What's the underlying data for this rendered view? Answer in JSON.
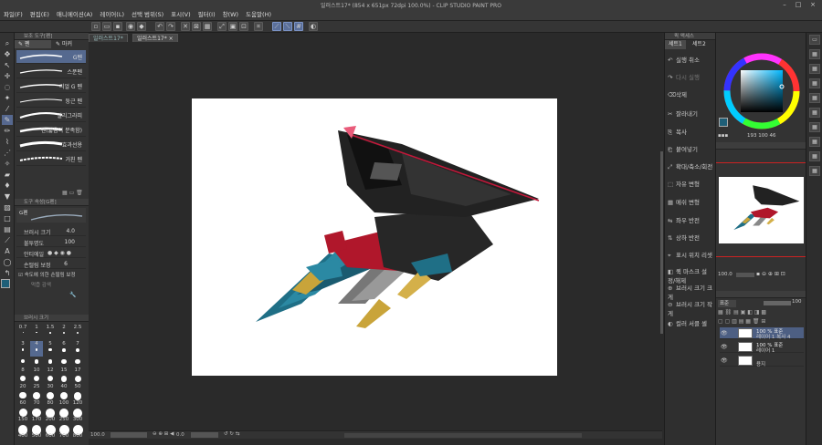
{
  "window": {
    "title": "일러스트17* (854 x 651px 72dpi 100.0%) - CLIP STUDIO PAINT PRO"
  },
  "menu": [
    "파일(F)",
    "편집(E)",
    "애니메이션(A)",
    "레이어(L)",
    "선택 범위(S)",
    "표시(V)",
    "필터(I)",
    "창(W)",
    "도움말(H)"
  ],
  "document_tabs": [
    "일러스트17*",
    "일러스트17*"
  ],
  "left_panel": {
    "subtool_header": "보조 도구[펜]",
    "subtabs": [
      "펜",
      "마커"
    ],
    "brushes": [
      "G펜",
      "스푼펜",
      "리얼 G 펜",
      "둥근 펜",
      "멀리그라피",
      "펜(얇음이 분족함)",
      "효과선용",
      "거친 펜"
    ],
    "tool_property_header": "도구 속성[G펜]",
    "tool_property_name": "G펜",
    "props": [
      {
        "label": "브러시 크기",
        "value": "4.0"
      },
      {
        "label": "불투명도",
        "value": "100"
      },
      {
        "label": "안티에일",
        "value": ""
      },
      {
        "label": "손떨림 보정",
        "value": "6"
      }
    ],
    "checkbox_label": "속도에 의한 손떨림 보정",
    "extra_label": "먹즙 감색",
    "brush_size_header": "브러시 크기",
    "sizes_row1": [
      "0.7",
      "1",
      "1.5",
      "2",
      "2.5"
    ],
    "sizes_row2": [
      "3",
      "4",
      "5",
      "6",
      "7"
    ],
    "sizes_row3": [
      "8",
      "10",
      "12",
      "15",
      "17"
    ],
    "sizes_row4": [
      "20",
      "25",
      "30",
      "40",
      "50"
    ],
    "sizes_row5": [
      "60",
      "70",
      "80",
      "100",
      "120"
    ],
    "sizes_row6": [
      "150",
      "170",
      "200",
      "250",
      "300"
    ],
    "sizes_row7": [
      "400",
      "500",
      "600",
      "700",
      "800"
    ]
  },
  "command_bar": {
    "header": "퀵 액세스",
    "tabs": [
      "세트1",
      "세트2"
    ],
    "items": [
      {
        "label": "실행 취소",
        "icon": "undo-icon",
        "disabled": false
      },
      {
        "label": "다시 실행",
        "icon": "redo-icon",
        "disabled": true
      },
      {
        "label": "삭제",
        "icon": "delete-icon",
        "disabled": false
      },
      {
        "label": "잘라내기",
        "icon": "cut-icon",
        "disabled": false
      },
      {
        "label": "복사",
        "icon": "copy-icon",
        "disabled": false
      },
      {
        "label": "붙여넣기",
        "icon": "paste-icon",
        "disabled": false
      },
      {
        "label": "확대/축소/회전",
        "icon": "transform-icon",
        "disabled": false
      },
      {
        "label": "자유 변형",
        "icon": "free-transform-icon",
        "disabled": false
      },
      {
        "label": "메쉬 변형",
        "icon": "mesh-icon",
        "disabled": false
      },
      {
        "label": "좌우 반전",
        "icon": "flip-h-icon",
        "disabled": false
      },
      {
        "label": "상하 반전",
        "icon": "flip-v-icon",
        "disabled": false
      },
      {
        "label": "표시 위치 리셋",
        "icon": "reset-view-icon",
        "disabled": false
      },
      {
        "label": "퀵 마스크 설정/해제",
        "icon": "quick-mask-icon",
        "disabled": false
      },
      {
        "label": "브러시 크기 크게",
        "icon": "brush-bigger-icon",
        "disabled": false
      },
      {
        "label": "브러시 크기 작게",
        "icon": "brush-smaller-icon",
        "disabled": false
      },
      {
        "label": "컬러 서클 셀",
        "icon": "color-icon",
        "disabled": false
      }
    ]
  },
  "color": {
    "readout": "193 100 46",
    "main_color": "#1f5f78",
    "sub_color": "#ffffff"
  },
  "layers": {
    "opacity": "100.0",
    "blend_mode": "표준",
    "opacity2": "100",
    "items": [
      {
        "line1": "100 % 표준",
        "line2": "레이어 1 복사 4",
        "selected": true
      },
      {
        "line1": "100 % 표준",
        "line2": "레이어 1",
        "selected": false
      },
      {
        "line1": "",
        "line2": "용지",
        "selected": false
      }
    ]
  },
  "status": {
    "zoom": "100.0",
    "angle": "0.0"
  }
}
